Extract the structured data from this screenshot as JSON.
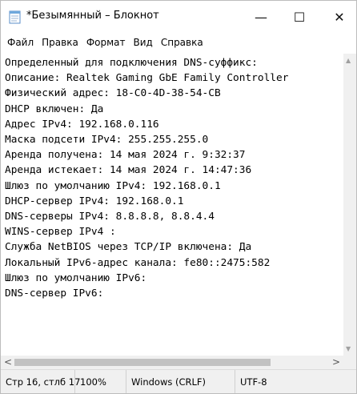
{
  "window": {
    "title": "*Безымянный – Блокнот",
    "app_icon": "notepad-icon",
    "controls": {
      "minimize": "—",
      "maximize": "☐",
      "close": "✕"
    }
  },
  "menu": {
    "items": [
      "Файл",
      "Правка",
      "Формат",
      "Вид",
      "Справка"
    ]
  },
  "editor": {
    "lines": [
      "Определенный для подключения DNS-суффикс:",
      "Описание: Realtek Gaming GbE Family Controller",
      "Физический адрес: 18-C0-4D-38-54-CB",
      "DHCP включен: Да",
      "Адрес IPv4: 192.168.0.116",
      "Маска подсети IPv4: 255.255.255.0",
      "Аренда получена: 14 мая 2024 г. 9:32:37",
      "Аренда истекает: 14 мая 2024 г. 14:47:36",
      "Шлюз по умолчанию IPv4: 192.168.0.1",
      "DHCP-сервер IPv4: 192.168.0.1",
      "DNS-серверы IPv4: 8.8.8.8, 8.8.4.4",
      "WINS-сервер IPv4 :",
      "Служба NetBIOS через TCP/IP включена: Да",
      "Локальный IPv6-адрес канала: fe80::2475:582",
      "Шлюз по умолчанию IPv6:",
      "DNS-сервер IPv6:"
    ]
  },
  "scrollbars": {
    "left_arrow": "<",
    "right_arrow": ">"
  },
  "status": {
    "position": "Стр 16, стлб 17",
    "zoom": "100%",
    "line_ending": "Windows (CRLF)",
    "encoding": "UTF-8"
  }
}
